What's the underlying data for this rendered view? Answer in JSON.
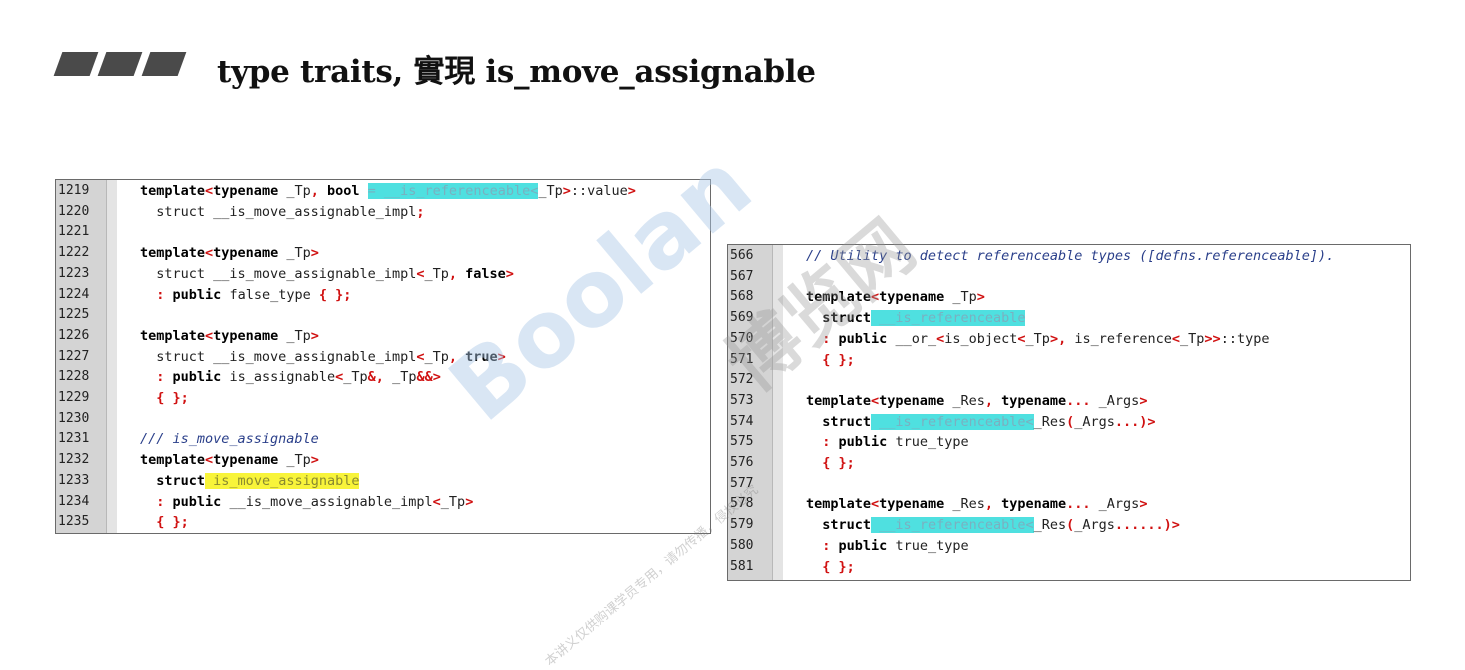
{
  "header": {
    "title": "type traits, 實現 is_move_assignable",
    "bullet_color": "#4a4a4a"
  },
  "left_panel": {
    "lines": [
      {
        "n": "1219",
        "code": [
          [
            "kw",
            "template"
          ],
          [
            "red",
            "<"
          ],
          [
            "kw",
            "typename"
          ],
          [
            "t",
            " _Tp"
          ],
          [
            "red",
            ","
          ],
          [
            "t",
            " "
          ],
          [
            "kw",
            "bool"
          ],
          [
            "t",
            " "
          ],
          [
            "cyan",
            "= __is_referenceable<"
          ],
          [
            "t",
            "_Tp"
          ],
          [
            "red",
            ">"
          ],
          [
            "t",
            "::value"
          ],
          [
            "red",
            ">"
          ]
        ]
      },
      {
        "n": "1220",
        "code": [
          [
            "t",
            "  struct __is_move_assignable_impl"
          ],
          [
            "red",
            ";"
          ]
        ]
      },
      {
        "n": "1221",
        "code": []
      },
      {
        "n": "1222",
        "code": [
          [
            "kw",
            "template"
          ],
          [
            "red",
            "<"
          ],
          [
            "kw",
            "typename"
          ],
          [
            "t",
            " _Tp"
          ],
          [
            "red",
            ">"
          ]
        ]
      },
      {
        "n": "1223",
        "code": [
          [
            "t",
            "  struct __is_move_assignable_impl"
          ],
          [
            "red",
            "<"
          ],
          [
            "t",
            "_Tp"
          ],
          [
            "red",
            ","
          ],
          [
            "t",
            " "
          ],
          [
            "kw",
            "false"
          ],
          [
            "red",
            ">"
          ]
        ]
      },
      {
        "n": "1224",
        "code": [
          [
            "t",
            "  "
          ],
          [
            "red",
            ":"
          ],
          [
            "t",
            " "
          ],
          [
            "kw",
            "public"
          ],
          [
            "t",
            " false_type "
          ],
          [
            "red",
            "{ };"
          ]
        ]
      },
      {
        "n": "1225",
        "code": []
      },
      {
        "n": "1226",
        "code": [
          [
            "kw",
            "template"
          ],
          [
            "red",
            "<"
          ],
          [
            "kw",
            "typename"
          ],
          [
            "t",
            " _Tp"
          ],
          [
            "red",
            ">"
          ]
        ]
      },
      {
        "n": "1227",
        "code": [
          [
            "t",
            "  struct __is_move_assignable_impl"
          ],
          [
            "red",
            "<"
          ],
          [
            "t",
            "_Tp"
          ],
          [
            "red",
            ","
          ],
          [
            "t",
            " "
          ],
          [
            "kw",
            "true"
          ],
          [
            "red",
            ">"
          ]
        ]
      },
      {
        "n": "1228",
        "code": [
          [
            "t",
            "  "
          ],
          [
            "red",
            ":"
          ],
          [
            "t",
            " "
          ],
          [
            "kw",
            "public"
          ],
          [
            "t",
            " is_assignable"
          ],
          [
            "red",
            "<"
          ],
          [
            "t",
            "_Tp"
          ],
          [
            "red",
            "&"
          ],
          [
            "red",
            ","
          ],
          [
            "t",
            " _Tp"
          ],
          [
            "red",
            "&&>"
          ]
        ]
      },
      {
        "n": "1229",
        "code": [
          [
            "t",
            "  "
          ],
          [
            "red",
            "{ };"
          ]
        ]
      },
      {
        "n": "1230",
        "code": []
      },
      {
        "n": "1231",
        "code": [
          [
            "cmt",
            "/// is_move_assignable"
          ]
        ]
      },
      {
        "n": "1232",
        "code": [
          [
            "kw",
            "template"
          ],
          [
            "red",
            "<"
          ],
          [
            "kw",
            "typename"
          ],
          [
            "t",
            " _Tp"
          ],
          [
            "red",
            ">"
          ]
        ]
      },
      {
        "n": "1233",
        "code": [
          [
            "t",
            "  "
          ],
          [
            "kw",
            "struct"
          ],
          [
            "yellow",
            " is_move_assignable"
          ]
        ]
      },
      {
        "n": "1234",
        "code": [
          [
            "t",
            "  "
          ],
          [
            "red",
            ":"
          ],
          [
            "t",
            " "
          ],
          [
            "kw",
            "public"
          ],
          [
            "t",
            " __is_move_assignable_impl"
          ],
          [
            "red",
            "<"
          ],
          [
            "t",
            "_Tp"
          ],
          [
            "red",
            ">"
          ]
        ]
      },
      {
        "n": "1235",
        "code": [
          [
            "t",
            "  "
          ],
          [
            "red",
            "{ };"
          ]
        ]
      }
    ]
  },
  "right_panel": {
    "lines": [
      {
        "n": "566",
        "code": [
          [
            "cmt",
            "// Utility to detect referenceable types ([defns.referenceable])."
          ]
        ]
      },
      {
        "n": "567",
        "code": []
      },
      {
        "n": "568",
        "code": [
          [
            "kw",
            "template"
          ],
          [
            "red",
            "<"
          ],
          [
            "kw",
            "typename"
          ],
          [
            "t",
            " _Tp"
          ],
          [
            "red",
            ">"
          ]
        ]
      },
      {
        "n": "569",
        "code": [
          [
            "t",
            "  "
          ],
          [
            "kw",
            "struct"
          ],
          [
            "cyan",
            " __is_referenceable"
          ]
        ]
      },
      {
        "n": "570",
        "code": [
          [
            "t",
            "  "
          ],
          [
            "red",
            ":"
          ],
          [
            "t",
            " "
          ],
          [
            "kw",
            "public"
          ],
          [
            "t",
            " __or_"
          ],
          [
            "red",
            "<"
          ],
          [
            "t",
            "is_object"
          ],
          [
            "red",
            "<"
          ],
          [
            "t",
            "_Tp"
          ],
          [
            "red",
            ">"
          ],
          [
            "red",
            ","
          ],
          [
            "t",
            " is_reference"
          ],
          [
            "red",
            "<"
          ],
          [
            "t",
            "_Tp"
          ],
          [
            "red",
            ">>"
          ],
          [
            "t",
            "::type"
          ]
        ]
      },
      {
        "n": "571",
        "code": [
          [
            "t",
            "  "
          ],
          [
            "red",
            "{ };"
          ]
        ]
      },
      {
        "n": "572",
        "code": []
      },
      {
        "n": "573",
        "code": [
          [
            "kw",
            "template"
          ],
          [
            "red",
            "<"
          ],
          [
            "kw",
            "typename"
          ],
          [
            "t",
            " _Res"
          ],
          [
            "red",
            ","
          ],
          [
            "t",
            " "
          ],
          [
            "kw",
            "typename"
          ],
          [
            "red",
            "..."
          ],
          [
            "t",
            " _Args"
          ],
          [
            "red",
            ">"
          ]
        ]
      },
      {
        "n": "574",
        "code": [
          [
            "t",
            "  "
          ],
          [
            "kw",
            "struct"
          ],
          [
            "cyan",
            " __is_referenceable<"
          ],
          [
            "t",
            "_Res"
          ],
          [
            "red",
            "("
          ],
          [
            "t",
            "_Args"
          ],
          [
            "red",
            "...)>"
          ]
        ]
      },
      {
        "n": "575",
        "code": [
          [
            "t",
            "  "
          ],
          [
            "red",
            ":"
          ],
          [
            "t",
            " "
          ],
          [
            "kw",
            "public"
          ],
          [
            "t",
            " true_type"
          ]
        ]
      },
      {
        "n": "576",
        "code": [
          [
            "t",
            "  "
          ],
          [
            "red",
            "{ };"
          ]
        ]
      },
      {
        "n": "577",
        "code": []
      },
      {
        "n": "578",
        "code": [
          [
            "kw",
            "template"
          ],
          [
            "red",
            "<"
          ],
          [
            "kw",
            "typename"
          ],
          [
            "t",
            " _Res"
          ],
          [
            "red",
            ","
          ],
          [
            "t",
            " "
          ],
          [
            "kw",
            "typename"
          ],
          [
            "red",
            "..."
          ],
          [
            "t",
            " _Args"
          ],
          [
            "red",
            ">"
          ]
        ]
      },
      {
        "n": "579",
        "code": [
          [
            "t",
            "  "
          ],
          [
            "kw",
            "struct"
          ],
          [
            "cyan",
            " __is_referenceable<"
          ],
          [
            "t",
            "_Res"
          ],
          [
            "red",
            "("
          ],
          [
            "t",
            "_Args"
          ],
          [
            "red",
            "......)>"
          ]
        ]
      },
      {
        "n": "580",
        "code": [
          [
            "t",
            "  "
          ],
          [
            "red",
            ":"
          ],
          [
            "t",
            " "
          ],
          [
            "kw",
            "public"
          ],
          [
            "t",
            " true_type"
          ]
        ]
      },
      {
        "n": "581",
        "code": [
          [
            "t",
            "  "
          ],
          [
            "red",
            "{ };"
          ]
        ]
      }
    ]
  },
  "colors": {
    "highlight_cyan": "#4fe0e0",
    "highlight_yellow": "#f8f43a",
    "keyword_red": "#d01010",
    "comment_blue": "#2a3f8a"
  },
  "watermarks": {
    "main": "Boolan",
    "secondary": "博览网",
    "footer": "本讲义仅供购课学员专用，请勿传播，侵权必究"
  }
}
